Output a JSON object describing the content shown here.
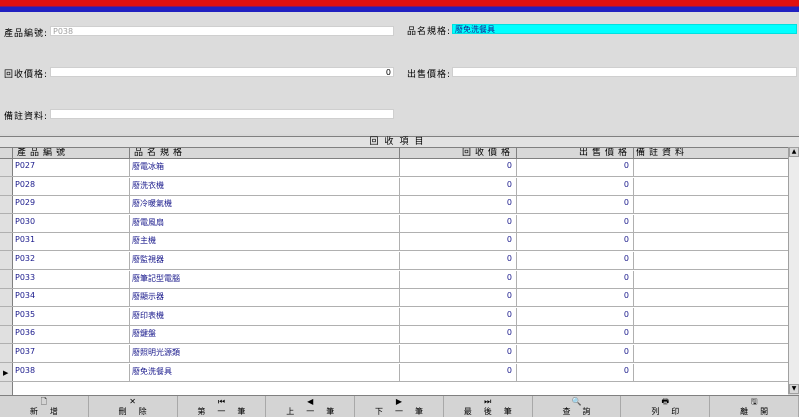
{
  "form": {
    "product_no_label": "產品編號:",
    "product_no_value": "P038",
    "spec_label": "品名規格:",
    "spec_value": "廢免洗餐具",
    "recycle_price_label": "回收價格:",
    "recycle_price_value": "0",
    "sale_price_label": "出售價格:",
    "sale_price_value": "",
    "note_label": "備註資料:",
    "note_value": ""
  },
  "grid": {
    "title": "回收項目",
    "columns": [
      "產品編號",
      "品名規格",
      "回收價格",
      "出售價格",
      "備註資料"
    ],
    "rows": [
      {
        "no": "P027",
        "spec": "廢電冰箱",
        "recycle": "0",
        "sale": "0",
        "note": ""
      },
      {
        "no": "P028",
        "spec": "廢洗衣機",
        "recycle": "0",
        "sale": "0",
        "note": ""
      },
      {
        "no": "P029",
        "spec": "廢冷暖氣機",
        "recycle": "0",
        "sale": "0",
        "note": ""
      },
      {
        "no": "P030",
        "spec": "廢電風扇",
        "recycle": "0",
        "sale": "0",
        "note": ""
      },
      {
        "no": "P031",
        "spec": "廢主機",
        "recycle": "0",
        "sale": "0",
        "note": ""
      },
      {
        "no": "P032",
        "spec": "廢監視器",
        "recycle": "0",
        "sale": "0",
        "note": ""
      },
      {
        "no": "P033",
        "spec": "廢筆記型電腦",
        "recycle": "0",
        "sale": "0",
        "note": ""
      },
      {
        "no": "P034",
        "spec": "廢顯示器",
        "recycle": "0",
        "sale": "0",
        "note": ""
      },
      {
        "no": "P035",
        "spec": "廢印表機",
        "recycle": "0",
        "sale": "0",
        "note": ""
      },
      {
        "no": "P036",
        "spec": "廢鍵盤",
        "recycle": "0",
        "sale": "0",
        "note": ""
      },
      {
        "no": "P037",
        "spec": "廢照明光源類",
        "recycle": "0",
        "sale": "0",
        "note": ""
      },
      {
        "no": "P038",
        "spec": "廢免洗餐具",
        "recycle": "0",
        "sale": "0",
        "note": ""
      }
    ],
    "current_row_marker": "▶"
  },
  "toolbar": {
    "buttons": [
      {
        "label": "新增",
        "icon": "new-document-icon",
        "glyph": "🗋"
      },
      {
        "label": "刪除",
        "icon": "delete-x-icon",
        "glyph": "✕"
      },
      {
        "label": "第一筆",
        "icon": "first-record-icon",
        "glyph": "⏮"
      },
      {
        "label": "上一筆",
        "icon": "previous-record-icon",
        "glyph": "◀"
      },
      {
        "label": "下一筆",
        "icon": "next-record-icon",
        "glyph": "▶"
      },
      {
        "label": "最後筆",
        "icon": "last-record-icon",
        "glyph": "⏭"
      },
      {
        "label": "查詢",
        "icon": "search-icon",
        "glyph": "🔍"
      },
      {
        "label": "列印",
        "icon": "printer-icon",
        "glyph": "🖶"
      },
      {
        "label": "離開",
        "icon": "save-disk-icon",
        "glyph": "🖫"
      }
    ]
  },
  "colors": {
    "title_red": "#e01010",
    "title_blue": "#2020c0",
    "highlight": "#00ffff",
    "text_blue": "#1a1a8c"
  }
}
